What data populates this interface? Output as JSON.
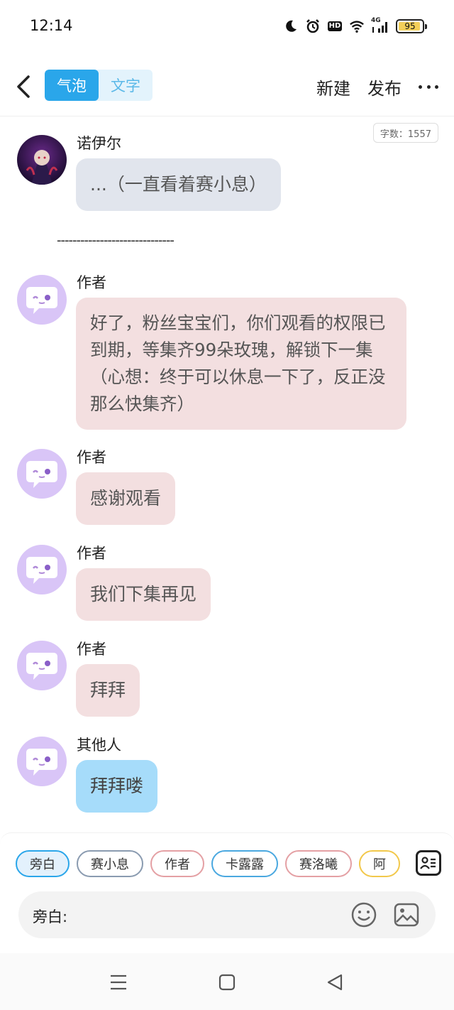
{
  "status_bar": {
    "time": "12:14",
    "network": "4G",
    "hd": "HD",
    "battery": "95",
    "battery_level": 0.95
  },
  "header": {
    "tabs": [
      {
        "label": "气泡",
        "active": true
      },
      {
        "label": "文字",
        "active": false
      }
    ],
    "new_label": "新建",
    "publish_label": "发布"
  },
  "word_count": "字数：1557",
  "messages": [
    {
      "sender": "诺伊尔",
      "text": "...（一直看着赛小息）",
      "style": "grey",
      "avatar": "character-avatar"
    },
    {
      "sender": "作者",
      "text": "好了，粉丝宝宝们，你们观看的权限已到期，等集齐99朵玫瑰，解锁下一集（心想：终于可以休息一下了，反正没那么快集齐）",
      "style": "pink",
      "avatar": "chat-bot-icon"
    },
    {
      "sender": "作者",
      "text": "感谢观看",
      "style": "pink",
      "avatar": "chat-bot-icon"
    },
    {
      "sender": "作者",
      "text": "我们下集再见",
      "style": "pink",
      "avatar": "chat-bot-icon"
    },
    {
      "sender": "作者",
      "text": "拜拜",
      "style": "pink",
      "avatar": "chat-bot-icon"
    },
    {
      "sender": "其他人",
      "text": "拜拜喽",
      "style": "blue",
      "avatar": "chat-bot-icon"
    }
  ],
  "divider": "------------------------------",
  "characters": [
    {
      "label": "旁白",
      "active": true,
      "color": "#2aa6ea"
    },
    {
      "label": "赛小息",
      "active": false,
      "color": "#8a9bb0"
    },
    {
      "label": "作者",
      "active": false,
      "color": "#e4a0a4"
    },
    {
      "label": "卡露露",
      "active": false,
      "color": "#4aa8e0"
    },
    {
      "label": "赛洛曦",
      "active": false,
      "color": "#e4a0a4"
    },
    {
      "label": "阿",
      "active": false,
      "color": "#f2c84b"
    }
  ],
  "input": {
    "label": "旁白:",
    "placeholder": "",
    "value": ""
  },
  "colors": {
    "accent": "#2aa6ea",
    "grey_bubble": "#e1e5ed",
    "pink_bubble": "#f3dfe0",
    "blue_bubble": "#a6dcfa",
    "bot_avatar": "#d9c5f7"
  }
}
